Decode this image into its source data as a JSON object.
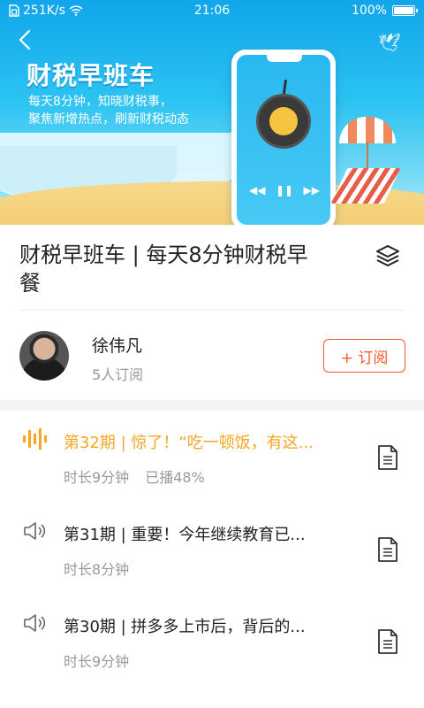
{
  "status_bar": {
    "speed": "251K/s",
    "time": "21:06",
    "battery": "100%",
    "battery_level": 1.0
  },
  "banner": {
    "title": "财税早班车",
    "subtitle_line1": "每天8分钟，知晓财税事，",
    "subtitle_line2": "聚焦新增热点，刷新财税动态"
  },
  "header": {
    "title": "财税早班车 | 每天8分钟财税早餐"
  },
  "author": {
    "name": "徐伟凡",
    "subscribers": "5人订阅",
    "subscribe_label": "+ 订阅"
  },
  "episodes": [
    {
      "title": "第32期 | 惊了！“吃一顿饭，有这...",
      "duration": "时长9分钟",
      "progress": "已播48%",
      "playing": true
    },
    {
      "title": "第31期 | 重要！今年继续教育已...",
      "duration": "时长8分钟",
      "progress": "",
      "playing": false
    },
    {
      "title": "第30期 | 拼多多上市后，背后的...",
      "duration": "时长9分钟",
      "progress": "",
      "playing": false
    }
  ],
  "colors": {
    "accent_orange": "#f05a28",
    "playing_yellow": "#f5a623",
    "banner_blue": "#12a6ea"
  }
}
